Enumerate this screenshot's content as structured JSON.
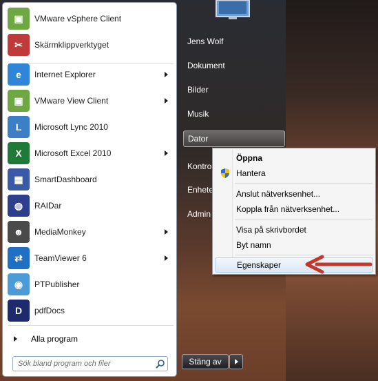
{
  "pinned": [
    {
      "label": "VMware vSphere Client",
      "icon": "vmware-vsphere-icon",
      "color": "#6fa842",
      "arrow": false
    },
    {
      "label": "Skärmklippverktyget",
      "icon": "scissors-icon",
      "color": "#c03a3a",
      "arrow": false
    }
  ],
  "recent": [
    {
      "label": "Internet Explorer",
      "icon": "internet-explorer-icon",
      "color": "#2f86d8",
      "arrow": true
    },
    {
      "label": "VMware View Client",
      "icon": "vmware-view-icon",
      "color": "#6fa842",
      "arrow": true
    },
    {
      "label": "Microsoft Lync 2010",
      "icon": "lync-icon",
      "color": "#3c7fc7",
      "arrow": false
    },
    {
      "label": "Microsoft Excel 2010",
      "icon": "excel-icon",
      "color": "#1f7a3a",
      "arrow": true
    },
    {
      "label": "SmartDashboard",
      "icon": "smartdashboard-icon",
      "color": "#3a5aa8",
      "arrow": false
    },
    {
      "label": "RAIDar",
      "icon": "raidar-icon",
      "color": "#2c3e8c",
      "arrow": false
    },
    {
      "label": "MediaMonkey",
      "icon": "mediamonkey-icon",
      "color": "#4a4a4a",
      "arrow": true
    },
    {
      "label": "TeamViewer 6",
      "icon": "teamviewer-icon",
      "color": "#1f6fc4",
      "arrow": true
    },
    {
      "label": "PTPublisher",
      "icon": "ptpublisher-icon",
      "color": "#4a9bd8",
      "arrow": false
    },
    {
      "label": "pdfDocs",
      "icon": "pdfdocs-icon",
      "color": "#1d2a6e",
      "arrow": false
    }
  ],
  "all_programs": "Alla program",
  "search": {
    "placeholder": "Sök bland program och filer"
  },
  "right_column": {
    "user": "Jens Wolf",
    "documents": "Dokument",
    "pictures": "Bilder",
    "music": "Musik",
    "computer": "Dator",
    "control_panel": "Kontro",
    "devices": "Enhete",
    "admin": "Admin"
  },
  "shutdown": {
    "label": "Stäng av"
  },
  "context_menu": {
    "open": "Öppna",
    "manage": "Hantera",
    "map_drive": "Anslut nätverksenhet...",
    "disconnect_drive": "Koppla från nätverksenhet...",
    "show_desktop": "Visa på skrivbordet",
    "rename": "Byt namn",
    "properties": "Egenskaper"
  },
  "colors": {
    "highlight_border": "#aecff7",
    "arrow": "#c0392b"
  }
}
